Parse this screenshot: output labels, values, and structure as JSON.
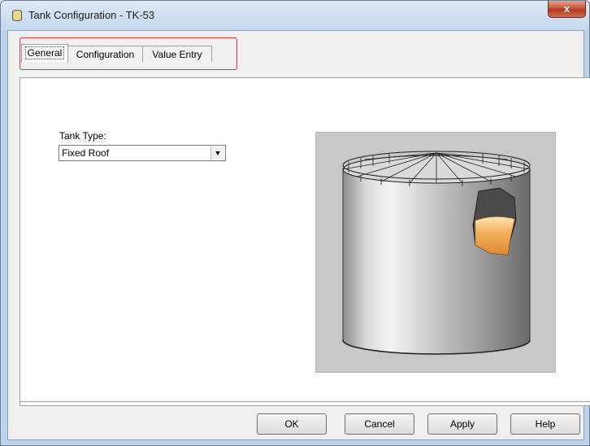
{
  "window": {
    "title": "Tank Configuration - TK-53",
    "close_label": "x"
  },
  "tabs": [
    {
      "label": "General",
      "active": true
    },
    {
      "label": "Configuration",
      "active": false
    },
    {
      "label": "Value Entry",
      "active": false
    }
  ],
  "general": {
    "tank_type_label": "Tank Type:",
    "tank_type_value": "Fixed Roof"
  },
  "image": {
    "name": "fixed-roof-tank-illustration",
    "liquid_color": "#f0a050"
  },
  "buttons": {
    "ok": "OK",
    "cancel": "Cancel",
    "apply": "Apply",
    "help": "Help"
  },
  "colors": {
    "highlight": "#e53935",
    "close": "#c9553b"
  }
}
